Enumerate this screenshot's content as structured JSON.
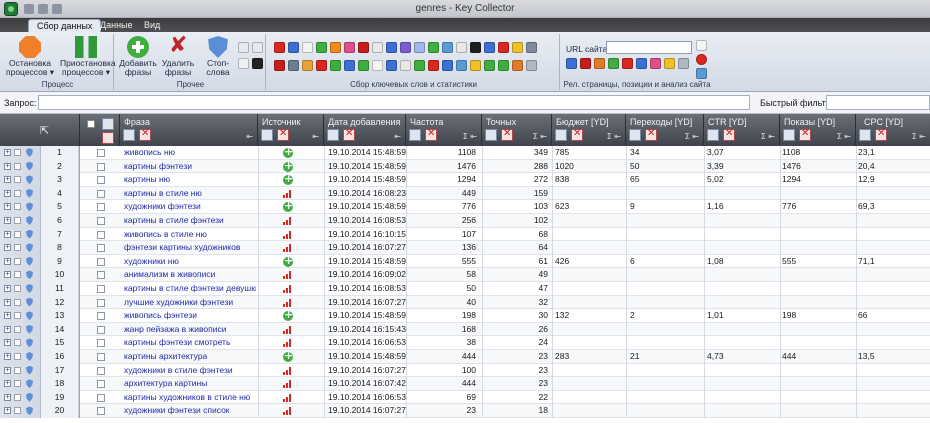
{
  "window": {
    "title": "genres - Key Collector"
  },
  "ribbon": {
    "tabs": [
      {
        "label": "Сбор данных",
        "active": true
      },
      {
        "label": "Данные",
        "active": false
      },
      {
        "label": "Вид",
        "active": false
      }
    ],
    "groups": {
      "process": {
        "label": "Процесс",
        "buttons": [
          {
            "label1": "Остановка",
            "label2": "процессов ▾",
            "icon": "stop-octagon-icon"
          },
          {
            "label1": "Приостановка",
            "label2": "процессов ▾",
            "icon": "pause-icon"
          }
        ]
      },
      "other": {
        "label": "Прочее",
        "buttons": [
          {
            "label1": "Добавить",
            "label2": "фразы",
            "icon": "add-icon"
          },
          {
            "label1": "Удалить",
            "label2": "фразы",
            "icon": "delete-icon"
          },
          {
            "label1": "Стоп-слова",
            "label2": "",
            "icon": "shield-icon"
          }
        ]
      },
      "collect": {
        "label": "Сбор ключевых слов и статистики"
      },
      "rel": {
        "label": "Рел. страницы, позиции и анализ сайта",
        "url_label": "URL сайта:",
        "url_value": ""
      }
    }
  },
  "querybar": {
    "query_label": "Запрос:",
    "query_value": "",
    "filter_label": "Быстрый фильтр:",
    "filter_value": ""
  },
  "table": {
    "columns": [
      {
        "key": "phrase",
        "title": "Фраза"
      },
      {
        "key": "source",
        "title": "Источник"
      },
      {
        "key": "date",
        "title": "Дата добавления"
      },
      {
        "key": "freq",
        "title": "Частота"
      },
      {
        "key": "exact",
        "title": "Точных"
      },
      {
        "key": "budget",
        "title": "Бюджет [YD]"
      },
      {
        "key": "clicks",
        "title": "Переходы [YD]"
      },
      {
        "key": "ctr",
        "title": "CTR [YD]"
      },
      {
        "key": "shows",
        "title": "Показы [YD]"
      },
      {
        "key": "cpc",
        "title": "CPC [YD]"
      }
    ],
    "rows": [
      {
        "n": "1",
        "phrase": "живопись ню",
        "source": "plus",
        "date": "19.10.2014 15:48:59",
        "freq": "1108",
        "exact": "349",
        "budget": "785",
        "clicks": "34",
        "ctr": "3,07",
        "shows": "1108",
        "cpc": "23,1"
      },
      {
        "n": "2",
        "phrase": "картины фэнтези",
        "source": "plus",
        "date": "19.10.2014 15:48:59",
        "freq": "1476",
        "exact": "288",
        "budget": "1020",
        "clicks": "50",
        "ctr": "3,39",
        "shows": "1476",
        "cpc": "20,4"
      },
      {
        "n": "3",
        "phrase": "картины ню",
        "source": "plus",
        "date": "19.10.2014 15:48:59",
        "freq": "1294",
        "exact": "272",
        "budget": "838",
        "clicks": "65",
        "ctr": "5,02",
        "shows": "1294",
        "cpc": "12,9"
      },
      {
        "n": "4",
        "phrase": "картины в стиле ню",
        "source": "bars",
        "date": "19.10.2014 16:08:23",
        "freq": "449",
        "exact": "159",
        "budget": "",
        "clicks": "",
        "ctr": "",
        "shows": "",
        "cpc": ""
      },
      {
        "n": "5",
        "phrase": "художники фэнтези",
        "source": "plus",
        "date": "19.10.2014 15:48:59",
        "freq": "776",
        "exact": "103",
        "budget": "623",
        "clicks": "9",
        "ctr": "1,16",
        "shows": "776",
        "cpc": "69,3"
      },
      {
        "n": "6",
        "phrase": "картины в стиле фэнтези",
        "source": "bars",
        "date": "19.10.2014 16:08:53",
        "freq": "256",
        "exact": "102",
        "budget": "",
        "clicks": "",
        "ctr": "",
        "shows": "",
        "cpc": ""
      },
      {
        "n": "7",
        "phrase": "живопись в стиле ню",
        "source": "bars",
        "date": "19.10.2014 16:10:15",
        "freq": "107",
        "exact": "68",
        "budget": "",
        "clicks": "",
        "ctr": "",
        "shows": "",
        "cpc": ""
      },
      {
        "n": "8",
        "phrase": "фэнтези картины художников",
        "source": "bars",
        "date": "19.10.2014 16:07:27",
        "freq": "136",
        "exact": "64",
        "budget": "",
        "clicks": "",
        "ctr": "",
        "shows": "",
        "cpc": ""
      },
      {
        "n": "9",
        "phrase": "художники ню",
        "source": "plus",
        "date": "19.10.2014 15:48:59",
        "freq": "555",
        "exact": "61",
        "budget": "426",
        "clicks": "6",
        "ctr": "1,08",
        "shows": "555",
        "cpc": "71,1"
      },
      {
        "n": "10",
        "phrase": "анимализм в живописи",
        "source": "bars",
        "date": "19.10.2014 16:09:02",
        "freq": "58",
        "exact": "49",
        "budget": "",
        "clicks": "",
        "ctr": "",
        "shows": "",
        "cpc": ""
      },
      {
        "n": "11",
        "phrase": "картины в стиле фэнтези девушки",
        "source": "bars",
        "date": "19.10.2014 16:08:53",
        "freq": "50",
        "exact": "47",
        "budget": "",
        "clicks": "",
        "ctr": "",
        "shows": "",
        "cpc": ""
      },
      {
        "n": "12",
        "phrase": "лучшие художники фэнтези",
        "source": "bars",
        "date": "19.10.2014 16:07:27",
        "freq": "40",
        "exact": "32",
        "budget": "",
        "clicks": "",
        "ctr": "",
        "shows": "",
        "cpc": ""
      },
      {
        "n": "13",
        "phrase": "живопись фэнтези",
        "source": "plus",
        "date": "19.10.2014 15:48:59",
        "freq": "198",
        "exact": "30",
        "budget": "132",
        "clicks": "2",
        "ctr": "1,01",
        "shows": "198",
        "cpc": "66"
      },
      {
        "n": "14",
        "phrase": "жанр пейзажа в живописи",
        "source": "bars",
        "date": "19.10.2014 16:15:43",
        "freq": "168",
        "exact": "26",
        "budget": "",
        "clicks": "",
        "ctr": "",
        "shows": "",
        "cpc": ""
      },
      {
        "n": "15",
        "phrase": "картины фэнтези смотреть",
        "source": "bars",
        "date": "19.10.2014 16:06:53",
        "freq": "38",
        "exact": "24",
        "budget": "",
        "clicks": "",
        "ctr": "",
        "shows": "",
        "cpc": ""
      },
      {
        "n": "16",
        "phrase": "картины архитектура",
        "source": "plus",
        "date": "19.10.2014 15:48:59",
        "freq": "444",
        "exact": "23",
        "budget": "283",
        "clicks": "21",
        "ctr": "4,73",
        "shows": "444",
        "cpc": "13,5"
      },
      {
        "n": "17",
        "phrase": "художники в стиле фэнтези",
        "source": "bars",
        "date": "19.10.2014 16:07:27",
        "freq": "100",
        "exact": "23",
        "budget": "",
        "clicks": "",
        "ctr": "",
        "shows": "",
        "cpc": ""
      },
      {
        "n": "18",
        "phrase": "архитектура картины",
        "source": "bars",
        "date": "19.10.2014 16:07:42",
        "freq": "444",
        "exact": "23",
        "budget": "",
        "clicks": "",
        "ctr": "",
        "shows": "",
        "cpc": ""
      },
      {
        "n": "19",
        "phrase": "картины художников в стиле ню",
        "source": "bars",
        "date": "19.10.2014 16:06:53",
        "freq": "69",
        "exact": "22",
        "budget": "",
        "clicks": "",
        "ctr": "",
        "shows": "",
        "cpc": ""
      },
      {
        "n": "20",
        "phrase": "художники фэнтези список",
        "source": "bars",
        "date": "19.10.2014 16:07:27",
        "freq": "23",
        "exact": "18",
        "budget": "",
        "clicks": "",
        "ctr": "",
        "shows": "",
        "cpc": ""
      }
    ]
  },
  "colors": {
    "phrase_link": "#1f2aa8",
    "source_plus": "#3fae3f",
    "source_bars": "#d8281f",
    "header_bg": "#4f535b"
  }
}
